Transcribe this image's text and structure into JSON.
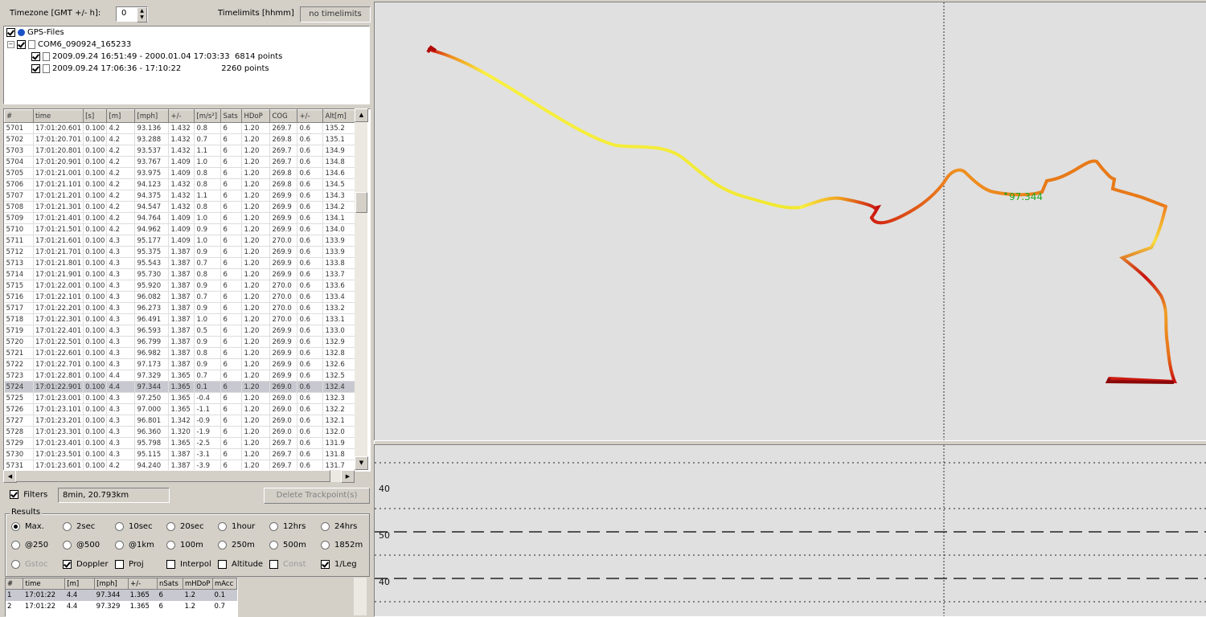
{
  "header": {
    "timezone_label": "Timezone [GMT +/- h]:",
    "timezone_value": "0",
    "timelimits_label": "Timelimits [hhmm]",
    "timelimits_button": "no timelimits"
  },
  "tree": {
    "root": "GPS-Files",
    "file": "COM6_090924_165233",
    "tracks": [
      {
        "range": "2009.09.24 16:51:49 - 2000.01.04 17:03:33",
        "points": "6814 points"
      },
      {
        "range": "2009.09.24 17:06:36 - 17:10:22",
        "points": "2260 points"
      }
    ]
  },
  "grid": {
    "columns": [
      "#",
      "time",
      "[s]",
      "[m]",
      "[mph]",
      "+/-",
      "[m/s²]",
      "Sats",
      "HDoP",
      "COG",
      "+/-",
      "Alt[m]"
    ],
    "rows": [
      [
        "5701",
        "17:01:20.601",
        "0.100",
        "4.2",
        "93.136",
        "1.432",
        "0.8",
        "6",
        "1.20",
        "269.7",
        "0.6",
        "135.2"
      ],
      [
        "5702",
        "17:01:20.701",
        "0.100",
        "4.2",
        "93.288",
        "1.432",
        "0.7",
        "6",
        "1.20",
        "269.8",
        "0.6",
        "135.1"
      ],
      [
        "5703",
        "17:01:20.801",
        "0.100",
        "4.2",
        "93.537",
        "1.432",
        "1.1",
        "6",
        "1.20",
        "269.7",
        "0.6",
        "134.9"
      ],
      [
        "5704",
        "17:01:20.901",
        "0.100",
        "4.2",
        "93.767",
        "1.409",
        "1.0",
        "6",
        "1.20",
        "269.7",
        "0.6",
        "134.8"
      ],
      [
        "5705",
        "17:01:21.001",
        "0.100",
        "4.2",
        "93.975",
        "1.409",
        "0.8",
        "6",
        "1.20",
        "269.8",
        "0.6",
        "134.6"
      ],
      [
        "5706",
        "17:01:21.101",
        "0.100",
        "4.2",
        "94.123",
        "1.432",
        "0.8",
        "6",
        "1.20",
        "269.8",
        "0.6",
        "134.5"
      ],
      [
        "5707",
        "17:01:21.201",
        "0.100",
        "4.2",
        "94.375",
        "1.432",
        "1.1",
        "6",
        "1.20",
        "269.9",
        "0.6",
        "134.3"
      ],
      [
        "5708",
        "17:01:21.301",
        "0.100",
        "4.2",
        "94.547",
        "1.432",
        "0.8",
        "6",
        "1.20",
        "269.9",
        "0.6",
        "134.2"
      ],
      [
        "5709",
        "17:01:21.401",
        "0.100",
        "4.2",
        "94.764",
        "1.409",
        "1.0",
        "6",
        "1.20",
        "269.9",
        "0.6",
        "134.1"
      ],
      [
        "5710",
        "17:01:21.501",
        "0.100",
        "4.2",
        "94.962",
        "1.409",
        "0.9",
        "6",
        "1.20",
        "269.9",
        "0.6",
        "134.0"
      ],
      [
        "5711",
        "17:01:21.601",
        "0.100",
        "4.3",
        "95.177",
        "1.409",
        "1.0",
        "6",
        "1.20",
        "270.0",
        "0.6",
        "133.9"
      ],
      [
        "5712",
        "17:01:21.701",
        "0.100",
        "4.3",
        "95.375",
        "1.387",
        "0.9",
        "6",
        "1.20",
        "269.9",
        "0.6",
        "133.9"
      ],
      [
        "5713",
        "17:01:21.801",
        "0.100",
        "4.3",
        "95.543",
        "1.387",
        "0.7",
        "6",
        "1.20",
        "269.9",
        "0.6",
        "133.8"
      ],
      [
        "5714",
        "17:01:21.901",
        "0.100",
        "4.3",
        "95.730",
        "1.387",
        "0.8",
        "6",
        "1.20",
        "269.9",
        "0.6",
        "133.7"
      ],
      [
        "5715",
        "17:01:22.001",
        "0.100",
        "4.3",
        "95.920",
        "1.387",
        "0.9",
        "6",
        "1.20",
        "270.0",
        "0.6",
        "133.6"
      ],
      [
        "5716",
        "17:01:22.101",
        "0.100",
        "4.3",
        "96.082",
        "1.387",
        "0.7",
        "6",
        "1.20",
        "270.0",
        "0.6",
        "133.4"
      ],
      [
        "5717",
        "17:01:22.201",
        "0.100",
        "4.3",
        "96.273",
        "1.387",
        "0.9",
        "6",
        "1.20",
        "270.0",
        "0.6",
        "133.2"
      ],
      [
        "5718",
        "17:01:22.301",
        "0.100",
        "4.3",
        "96.491",
        "1.387",
        "1.0",
        "6",
        "1.20",
        "270.0",
        "0.6",
        "133.1"
      ],
      [
        "5719",
        "17:01:22.401",
        "0.100",
        "4.3",
        "96.593",
        "1.387",
        "0.5",
        "6",
        "1.20",
        "269.9",
        "0.6",
        "133.0"
      ],
      [
        "5720",
        "17:01:22.501",
        "0.100",
        "4.3",
        "96.799",
        "1.387",
        "0.9",
        "6",
        "1.20",
        "269.9",
        "0.6",
        "132.9"
      ],
      [
        "5721",
        "17:01:22.601",
        "0.100",
        "4.3",
        "96.982",
        "1.387",
        "0.8",
        "6",
        "1.20",
        "269.9",
        "0.6",
        "132.8"
      ],
      [
        "5722",
        "17:01:22.701",
        "0.100",
        "4.3",
        "97.173",
        "1.387",
        "0.9",
        "6",
        "1.20",
        "269.9",
        "0.6",
        "132.6"
      ],
      [
        "5723",
        "17:01:22.801",
        "0.100",
        "4.4",
        "97.329",
        "1.365",
        "0.7",
        "6",
        "1.20",
        "269.9",
        "0.6",
        "132.5"
      ],
      [
        "5724",
        "17:01:22.901",
        "0.100",
        "4.4",
        "97.344",
        "1.365",
        "0.1",
        "6",
        "1.20",
        "269.0",
        "0.6",
        "132.4"
      ],
      [
        "5725",
        "17:01:23.001",
        "0.100",
        "4.3",
        "97.250",
        "1.365",
        "-0.4",
        "6",
        "1.20",
        "269.0",
        "0.6",
        "132.3"
      ],
      [
        "5726",
        "17:01:23.101",
        "0.100",
        "4.3",
        "97.000",
        "1.365",
        "-1.1",
        "6",
        "1.20",
        "269.0",
        "0.6",
        "132.2"
      ],
      [
        "5727",
        "17:01:23.201",
        "0.100",
        "4.3",
        "96.801",
        "1.342",
        "-0.9",
        "6",
        "1.20",
        "269.0",
        "0.6",
        "132.1"
      ],
      [
        "5728",
        "17:01:23.301",
        "0.100",
        "4.3",
        "96.360",
        "1.320",
        "-1.9",
        "6",
        "1.20",
        "269.0",
        "0.6",
        "132.0"
      ],
      [
        "5729",
        "17:01:23.401",
        "0.100",
        "4.3",
        "95.798",
        "1.365",
        "-2.5",
        "6",
        "1.20",
        "269.7",
        "0.6",
        "131.9"
      ],
      [
        "5730",
        "17:01:23.501",
        "0.100",
        "4.3",
        "95.115",
        "1.387",
        "-3.1",
        "6",
        "1.20",
        "269.7",
        "0.6",
        "131.8"
      ],
      [
        "5731",
        "17:01:23.601",
        "0.100",
        "4.2",
        "94.240",
        "1.387",
        "-3.9",
        "6",
        "1.20",
        "269.7",
        "0.6",
        "131.7"
      ]
    ],
    "selected_row": "5724"
  },
  "filters": {
    "label": "Filters",
    "status": "8min, 20.793km",
    "delete_button": "Delete Trackpoint(s)"
  },
  "results": {
    "title": "Results",
    "row1": [
      "Max.",
      "2sec",
      "10sec",
      "20sec",
      "1hour",
      "12hrs",
      "24hrs"
    ],
    "row2": [
      "@250",
      "@500",
      "@1km",
      "100m",
      "250m",
      "500m",
      "1852m"
    ],
    "row3": [
      "Gstoc",
      "Doppler",
      "Proj",
      "Interpol",
      "Altitude",
      "Const",
      "1/Leg"
    ],
    "columns": [
      "#",
      "time",
      "[m]",
      "[mph]",
      "+/-",
      "nSats",
      "mHDoP",
      "mAcc"
    ],
    "rows": [
      [
        "1",
        "17:01:22",
        "4.4",
        "97.344",
        "1.365",
        "6",
        "1.2",
        "0.1"
      ],
      [
        "2",
        "17:01:22",
        "4.4",
        "97.329",
        "1.365",
        "6",
        "1.2",
        "0.7"
      ]
    ]
  },
  "map": {
    "speed_label": "97.344",
    "label_color": "#22aa22"
  },
  "plot": {
    "y_labels": [
      "40",
      "50",
      "40"
    ]
  },
  "colors": {
    "track_fast": "#f8f040",
    "track_mid": "#f09020",
    "track_slow": "#c81010",
    "selection": "#c8c8d0"
  }
}
